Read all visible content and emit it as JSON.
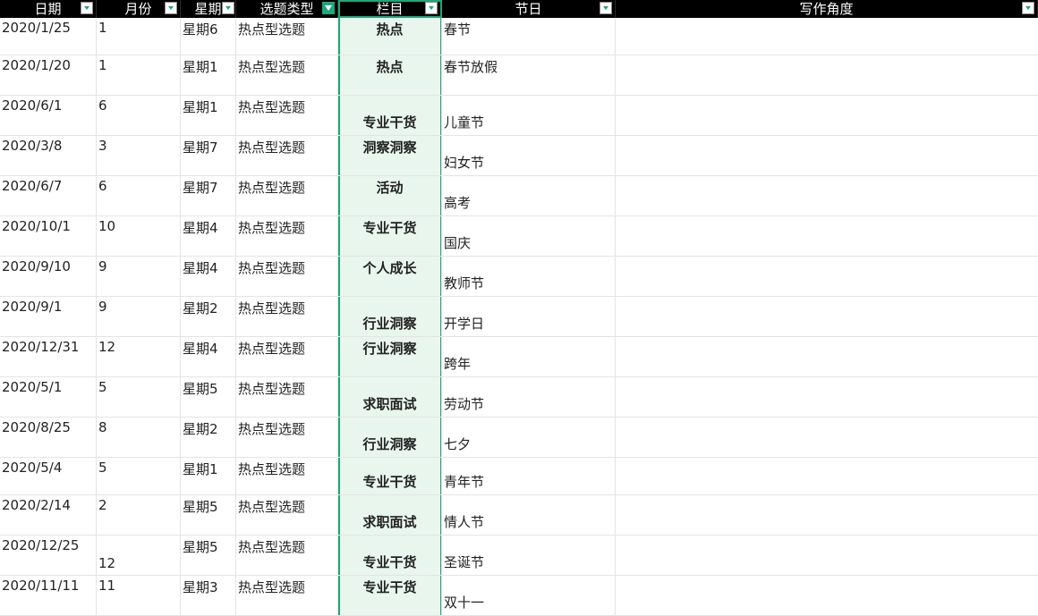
{
  "headers": {
    "date": "日期",
    "month": "月份",
    "week": "星期",
    "type": "选题类型",
    "column": "栏目",
    "festival": "节日",
    "angle": "写作角度"
  },
  "rows": [
    {
      "date": "2020/1/25",
      "month": "1",
      "week": "星期6",
      "type": "热点型选题",
      "column": "热点",
      "festival": "春节",
      "angle": ""
    },
    {
      "date": "2020/1/20",
      "month": "1",
      "week": "星期1",
      "type": "热点型选题",
      "column": "热点",
      "festival": "春节放假",
      "angle": ""
    },
    {
      "date": "2020/6/1",
      "month": "6",
      "week": "星期1",
      "type": "热点型选题",
      "column": "专业干货",
      "festival": "儿童节",
      "angle": ""
    },
    {
      "date": "2020/3/8",
      "month": "3",
      "week": "星期7",
      "type": "热点型选题",
      "column": "洞察洞察",
      "festival": "妇女节",
      "angle": ""
    },
    {
      "date": "2020/6/7",
      "month": "6",
      "week": "星期7",
      "type": "热点型选题",
      "column": "活动",
      "festival": "高考",
      "angle": ""
    },
    {
      "date": "2020/10/1",
      "month": "10",
      "week": "星期4",
      "type": "热点型选题",
      "column": "专业干货",
      "festival": "国庆",
      "angle": ""
    },
    {
      "date": "2020/9/10",
      "month": "9",
      "week": "星期4",
      "type": "热点型选题",
      "column": "个人成长",
      "festival": "教师节",
      "angle": ""
    },
    {
      "date": "2020/9/1",
      "month": "9",
      "week": "星期2",
      "type": "热点型选题",
      "column": "行业洞察",
      "festival": "开学日",
      "angle": ""
    },
    {
      "date": "2020/12/31",
      "month": "12",
      "week": "星期4",
      "type": "热点型选题",
      "column": "行业洞察",
      "festival": "跨年",
      "angle": ""
    },
    {
      "date": "2020/5/1",
      "month": "5",
      "week": "星期5",
      "type": "热点型选题",
      "column": "求职面试",
      "festival": "劳动节",
      "angle": ""
    },
    {
      "date": "2020/8/25",
      "month": "8",
      "week": "星期2",
      "type": "热点型选题",
      "column": "行业洞察",
      "festival": "七夕",
      "angle": ""
    },
    {
      "date": "2020/5/4",
      "month": "5",
      "week": "星期1",
      "type": "热点型选题",
      "column": "专业干货",
      "festival": "青年节",
      "angle": ""
    },
    {
      "date": "2020/2/14",
      "month": "2",
      "week": "星期5",
      "type": "热点型选题",
      "column": "求职面试",
      "festival": "情人节",
      "angle": ""
    },
    {
      "date": "2020/12/25",
      "month": "12",
      "week": "星期5",
      "type": "热点型选题",
      "column": "专业干货",
      "festival": "圣诞节",
      "angle": ""
    },
    {
      "date": "2020/11/11",
      "month": "11",
      "week": "星期3",
      "type": "热点型选题",
      "column": "专业干货",
      "festival": "双十一",
      "angle": ""
    }
  ]
}
